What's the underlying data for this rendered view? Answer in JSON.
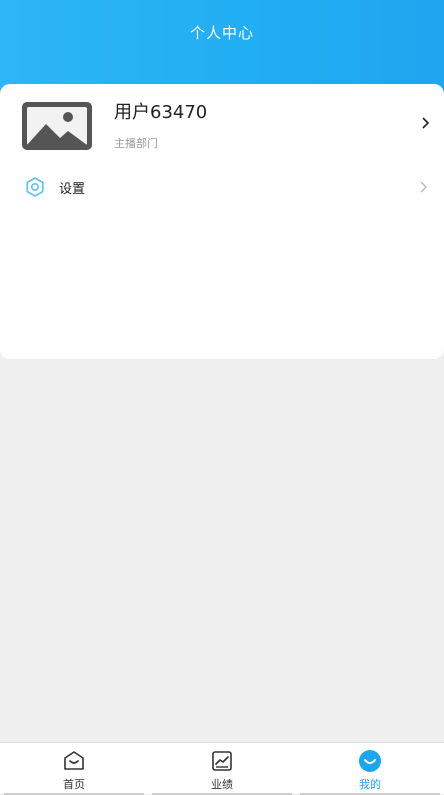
{
  "header": {
    "title": "个人中心"
  },
  "profile": {
    "username": "用户63470",
    "department": "主播部门",
    "arrow": ">"
  },
  "menu": {
    "items": [
      {
        "label": "设置",
        "icon": "gear-icon"
      }
    ]
  },
  "tabbar": {
    "tabs": [
      {
        "label": "首页",
        "icon": "home-icon"
      },
      {
        "label": "业绩",
        "icon": "chart-icon"
      },
      {
        "label": "我的",
        "icon": "profile-icon",
        "active": true
      }
    ]
  },
  "colors": {
    "accent": "#1aa7f0",
    "header_start": "#2cb6f5",
    "header_end": "#1ea6f0",
    "background": "#efefef"
  }
}
